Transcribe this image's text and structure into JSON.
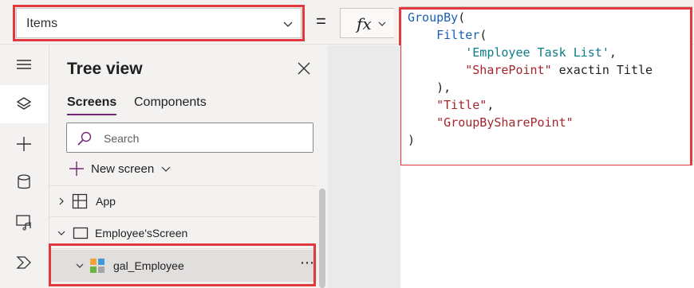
{
  "formula_bar": {
    "property": "Items",
    "equals": "=",
    "fx_label": "fx",
    "code_lines": [
      {
        "parts": [
          {
            "t": "GroupBy",
            "c": "kw"
          },
          {
            "t": "(",
            "c": ""
          }
        ]
      },
      {
        "parts": [
          {
            "t": "    ",
            "c": ""
          },
          {
            "t": "Filter",
            "c": "kw"
          },
          {
            "t": "(",
            "c": ""
          }
        ]
      },
      {
        "parts": [
          {
            "t": "        ",
            "c": ""
          },
          {
            "t": "'Employee Task List'",
            "c": "tbl"
          },
          {
            "t": ",",
            "c": ""
          }
        ]
      },
      {
        "parts": [
          {
            "t": "        ",
            "c": ""
          },
          {
            "t": "\"SharePoint\"",
            "c": "str"
          },
          {
            "t": " exactin Title",
            "c": ""
          }
        ]
      },
      {
        "parts": [
          {
            "t": "    ),",
            "c": ""
          }
        ]
      },
      {
        "parts": [
          {
            "t": "    ",
            "c": ""
          },
          {
            "t": "\"Title\"",
            "c": "str"
          },
          {
            "t": ",",
            "c": ""
          }
        ]
      },
      {
        "parts": [
          {
            "t": "    ",
            "c": ""
          },
          {
            "t": "\"GroupBySharePoint\"",
            "c": "str"
          }
        ]
      },
      {
        "parts": [
          {
            "t": ")",
            "c": ""
          }
        ]
      }
    ]
  },
  "tree_view": {
    "title": "Tree view",
    "tabs": [
      {
        "label": "Screens",
        "active": true
      },
      {
        "label": "Components",
        "active": false
      }
    ],
    "search_placeholder": "Search",
    "new_screen_label": "New screen",
    "nodes": [
      {
        "label": "App",
        "icon": "app-icon",
        "expanded": false
      },
      {
        "label": "Employee'sScreen",
        "icon": "screen-icon",
        "expanded": true
      },
      {
        "label": "gal_Employee",
        "icon": "gallery-icon",
        "expanded": true,
        "selected": true
      }
    ],
    "more_label": "⋯"
  },
  "colors": {
    "accent": "#742774",
    "highlight": "#e0393e",
    "keyword": "#1a5fb4",
    "string": "#a4262c",
    "table": "#0b7c8a"
  }
}
